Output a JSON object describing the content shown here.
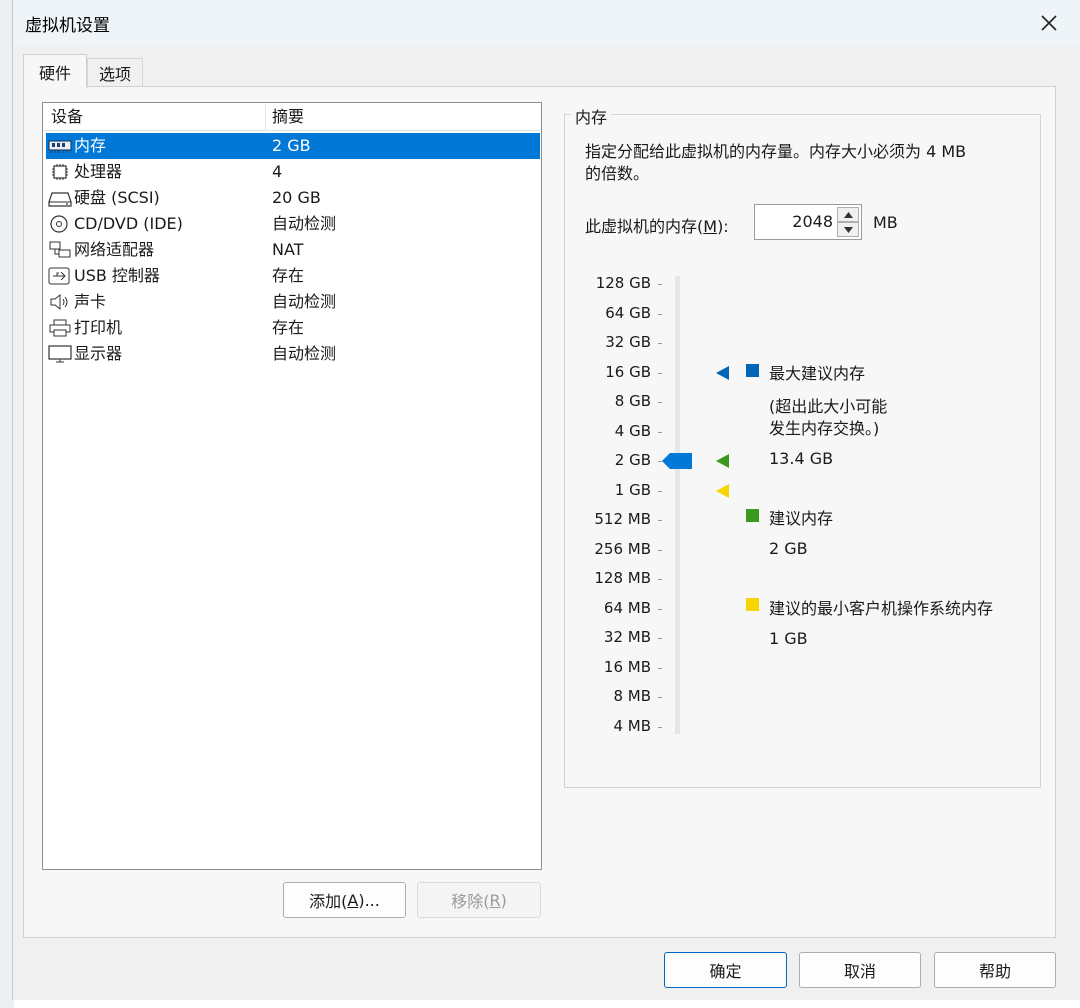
{
  "window": {
    "title": "虚拟机设置"
  },
  "tabs": [
    {
      "label": "硬件"
    },
    {
      "label": "选项"
    }
  ],
  "devices": {
    "headers": {
      "device": "设备",
      "summary": "摘要"
    },
    "rows": [
      {
        "name": "内存",
        "summary": "2 GB",
        "icon": "memory-icon",
        "selected": true
      },
      {
        "name": "处理器",
        "summary": "4",
        "icon": "processor-icon"
      },
      {
        "name": "硬盘 (SCSI)",
        "summary": "20 GB",
        "icon": "hard-disk-icon"
      },
      {
        "name": "CD/DVD (IDE)",
        "summary": "自动检测",
        "icon": "cd-dvd-icon"
      },
      {
        "name": "网络适配器",
        "summary": "NAT",
        "icon": "network-adapter-icon"
      },
      {
        "name": "USB 控制器",
        "summary": "存在",
        "icon": "usb-icon"
      },
      {
        "name": "声卡",
        "summary": "自动检测",
        "icon": "sound-card-icon"
      },
      {
        "name": "打印机",
        "summary": "存在",
        "icon": "printer-icon"
      },
      {
        "name": "显示器",
        "summary": "自动检测",
        "icon": "display-icon"
      }
    ]
  },
  "buttons": {
    "add": {
      "text": "添加(",
      "key": "A",
      "suffix": ")..."
    },
    "remove": {
      "text": "移除(",
      "key": "R",
      "suffix": ")"
    },
    "ok": "确定",
    "cancel": "取消",
    "help": "帮助"
  },
  "memory": {
    "group_title": "内存",
    "description_line1": "指定分配给此虚拟机的内存量。内存大小必须为 4 MB",
    "description_line2": "的倍数。",
    "field_label_prefix": "此虚拟机的内存(",
    "field_label_key": "M",
    "field_label_suffix": "):",
    "value": "2048",
    "unit": "MB",
    "scale": [
      "128 GB",
      "64 GB",
      "32 GB",
      "16 GB",
      "8 GB",
      "4 GB",
      "2 GB",
      "1 GB",
      "512 MB",
      "256 MB",
      "128 MB",
      "64 MB",
      "32 MB",
      "16 MB",
      "8 MB",
      "4 MB"
    ],
    "slider_value": "2 GB",
    "max_recommended": {
      "label": "最大建议内存",
      "note_line1": "(超出此大小可能",
      "note_line2": "发生内存交换。)",
      "value": "13.4 GB",
      "color": "#0067b8",
      "marker_level": "16 GB"
    },
    "recommended": {
      "label": "建议内存",
      "value": "2 GB",
      "color": "#3a9a1e",
      "marker_level": "2 GB"
    },
    "min_guest": {
      "label": "建议的最小客户机操作系统内存",
      "value": "1 GB",
      "color": "#f5d400",
      "marker_level": "1 GB"
    }
  },
  "colors": {
    "selection": "#0078d7",
    "slider_thumb": "#0078d7"
  }
}
